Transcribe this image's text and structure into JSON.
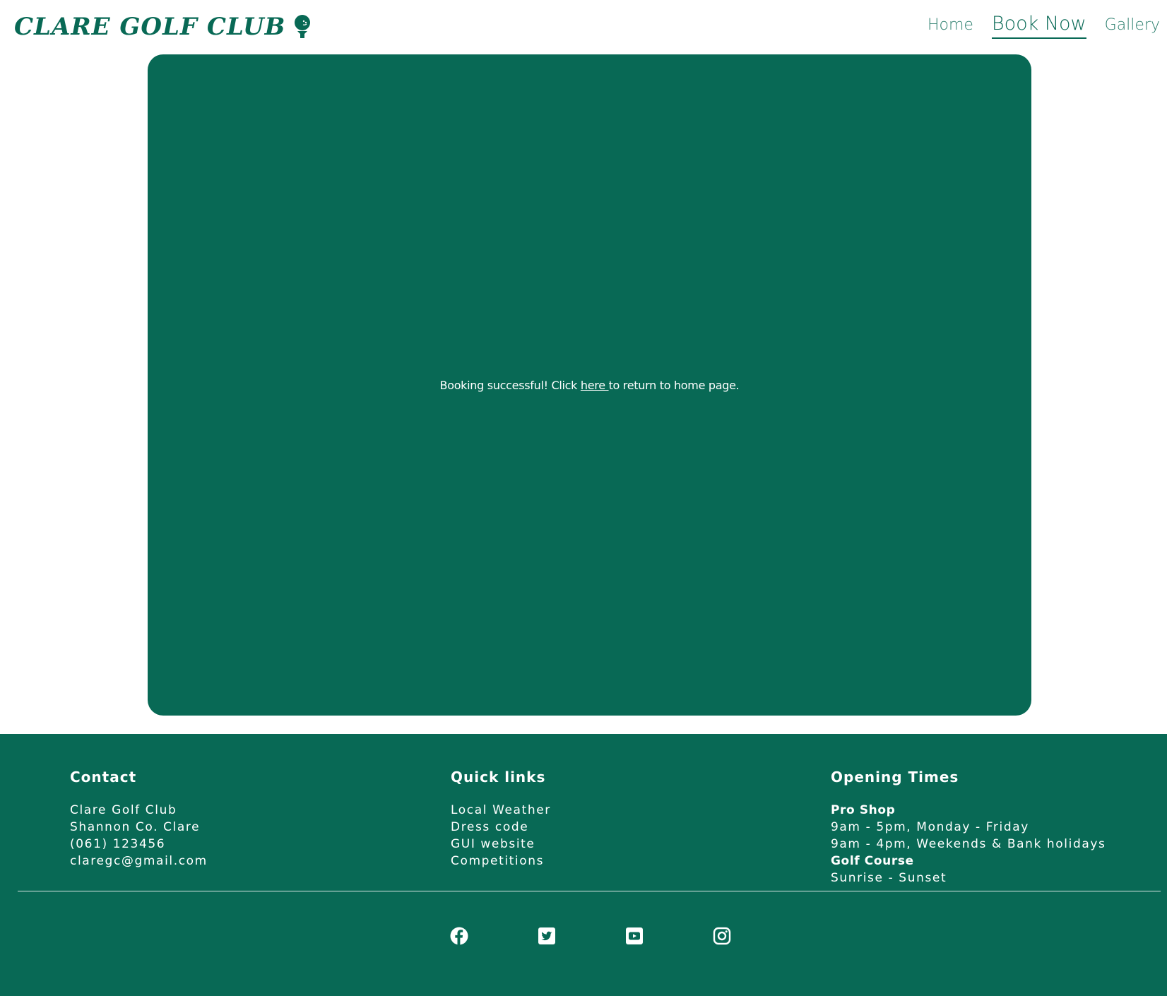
{
  "header": {
    "logo_text": "CLARE GOLF CLUB",
    "logo_icon": "golf-ball-on-tee-icon",
    "nav": [
      {
        "label": "Home"
      },
      {
        "label": "Book Now",
        "active": true
      },
      {
        "label": "Gallery"
      }
    ]
  },
  "main": {
    "message_before": "Booking successful! Click ",
    "link_text": "here ",
    "message_after": "to return to home page."
  },
  "footer": {
    "contact": {
      "heading": "Contact",
      "lines": [
        "Clare Golf Club",
        "Shannon Co. Clare",
        "(061) 123456",
        "claregc@gmail.com"
      ]
    },
    "quick_links": {
      "heading": "Quick links",
      "links": [
        "Local Weather",
        "Dress code",
        "GUI website",
        "Competitions"
      ]
    },
    "opening_times": {
      "heading": "Opening Times",
      "pro_shop_label": "Pro Shop",
      "pro_shop_lines": [
        "9am - 5pm, Monday - Friday",
        "9am - 4pm, Weekends & Bank holidays"
      ],
      "golf_course_label": "Golf Course",
      "golf_course_lines": [
        "Sunrise - Sunset"
      ]
    },
    "social": [
      "facebook-icon",
      "twitter-icon",
      "youtube-icon",
      "instagram-icon"
    ]
  },
  "colors": {
    "brand": "#086955",
    "text_on_brand": "#ffffff",
    "background": "#ffffff"
  }
}
